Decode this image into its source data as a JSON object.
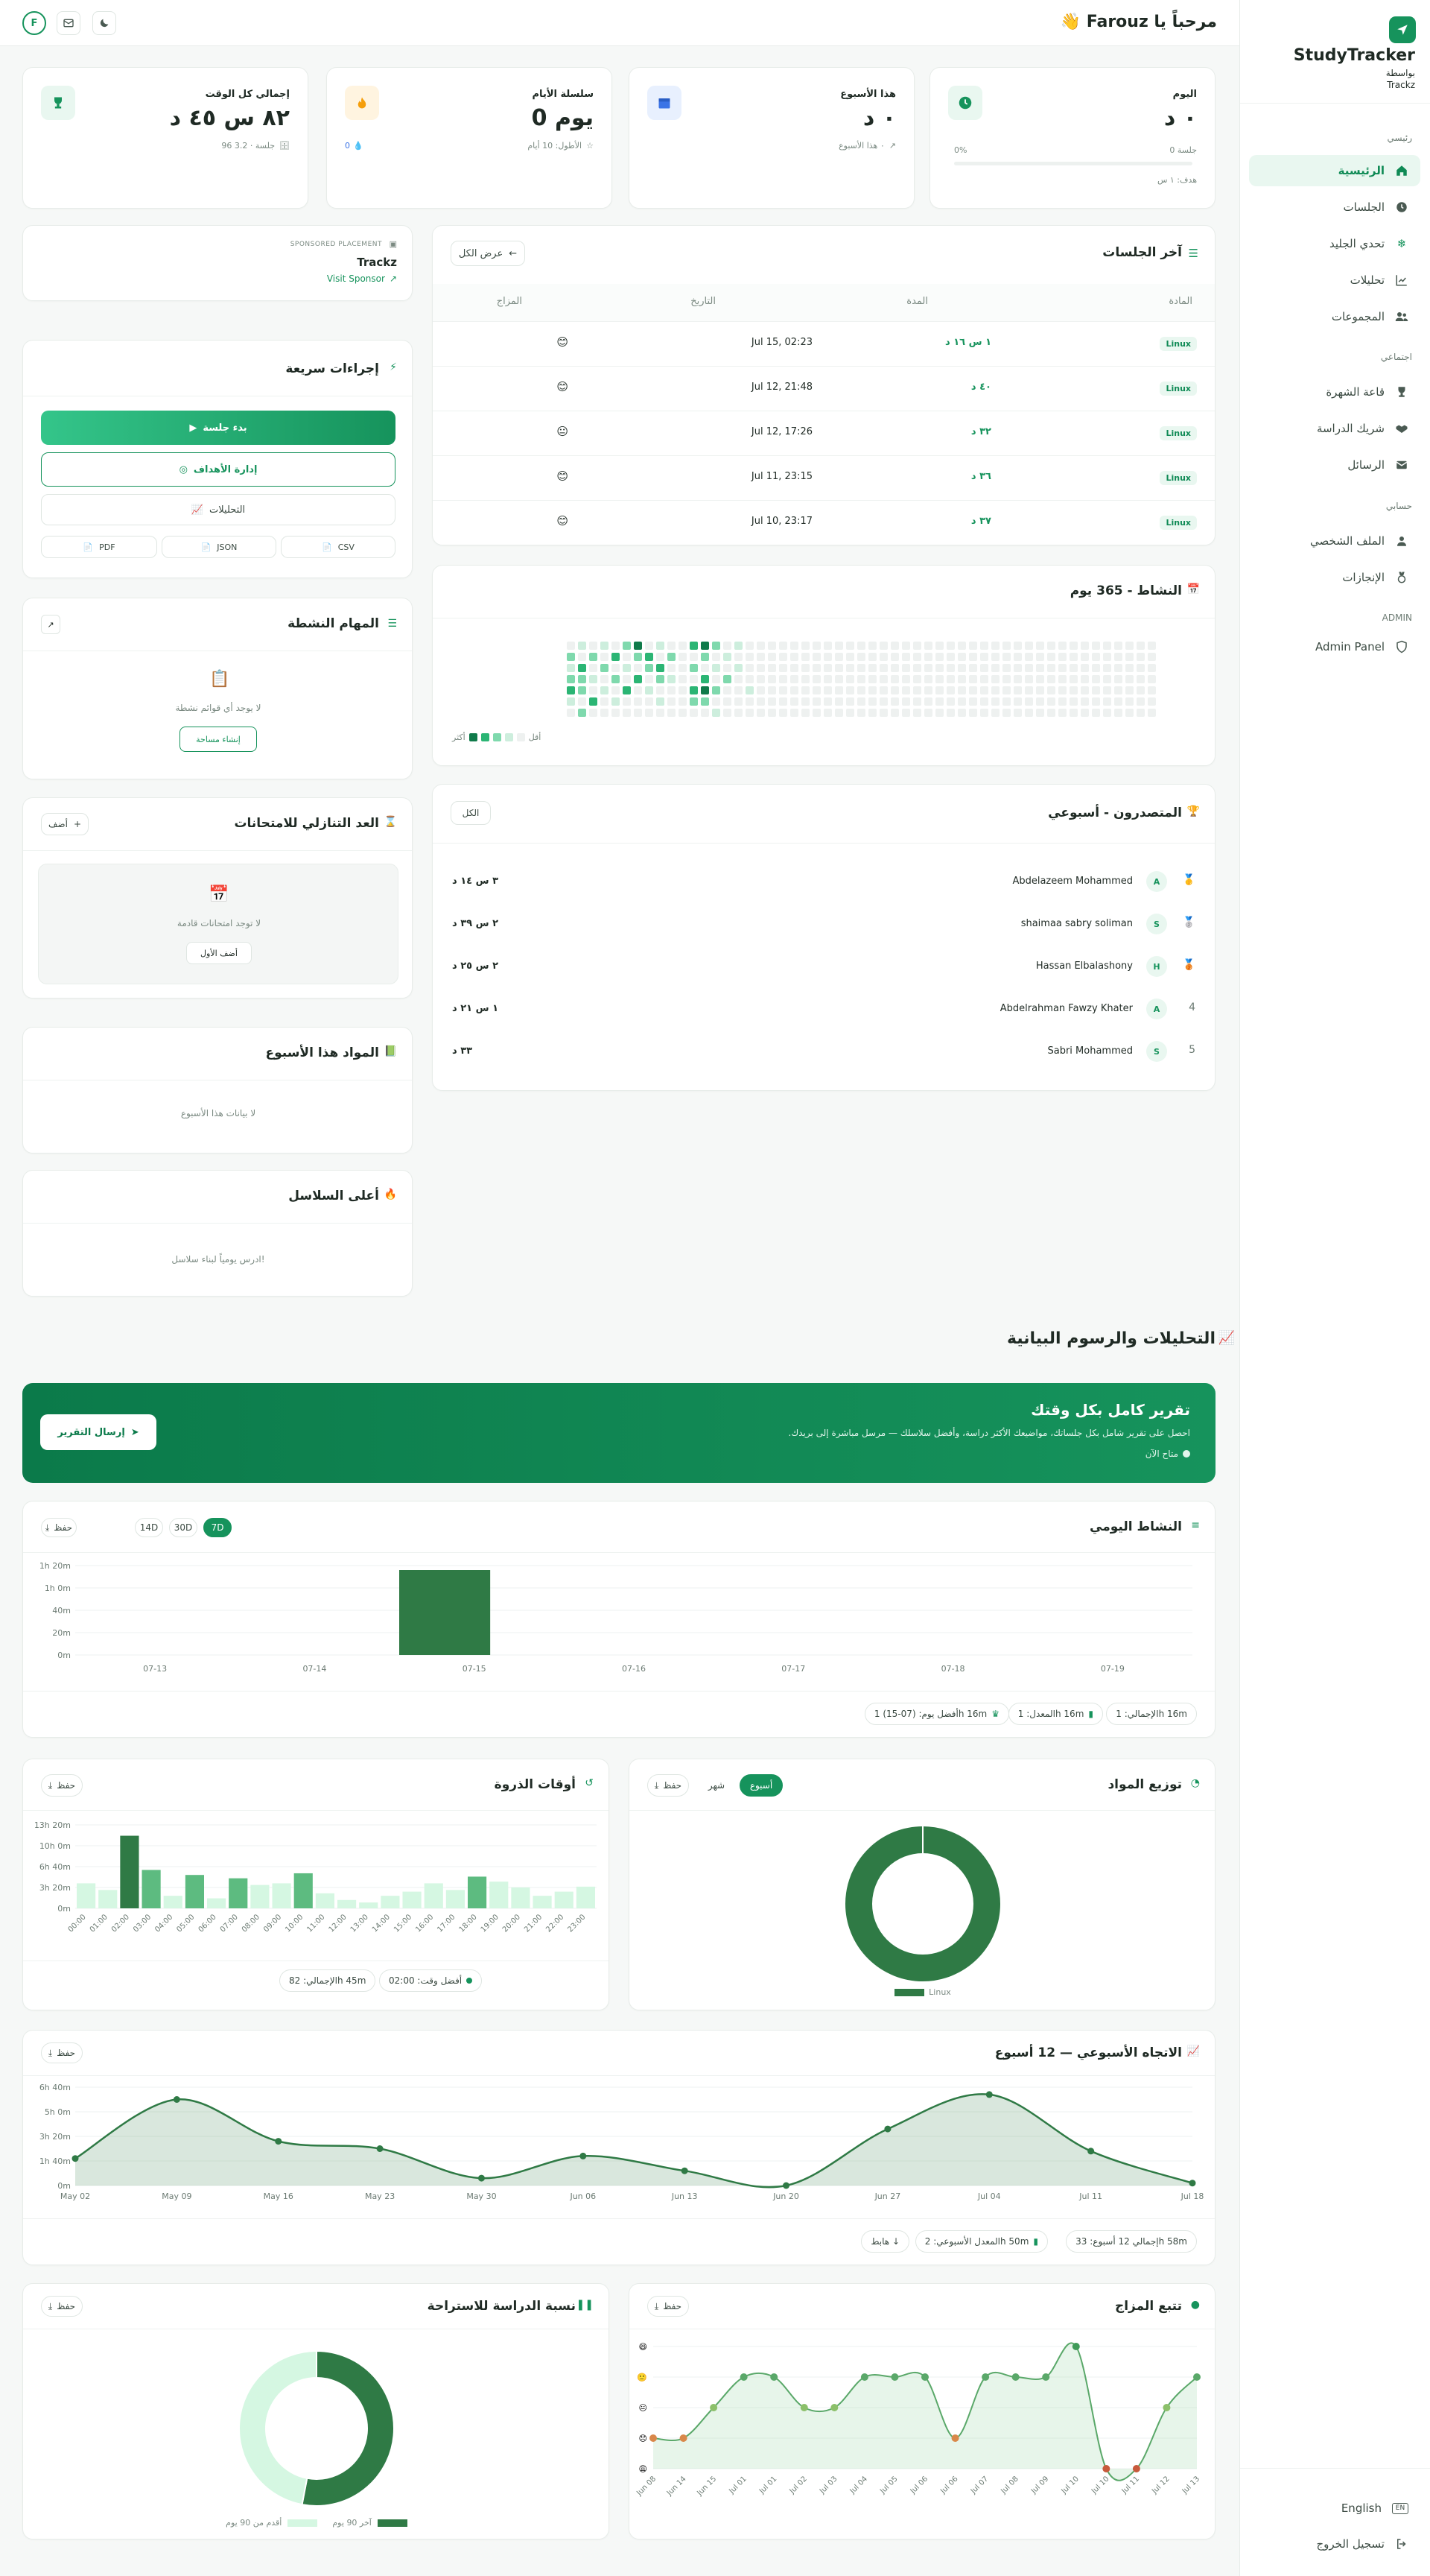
{
  "brand": {
    "name": "StudyTracker",
    "by": "بواسطة",
    "by_name": "Trackz"
  },
  "sidebar": {
    "sections": [
      "رئيسي",
      "اجتماعي",
      "حسابي",
      "ADMIN"
    ],
    "items": [
      {
        "label": "الرئيسية",
        "icon": "home-icon"
      },
      {
        "label": "الجلسات",
        "icon": "clock-icon"
      },
      {
        "label": "تحدي الجليد",
        "icon": "snowflake-icon"
      },
      {
        "label": "تحليلات",
        "icon": "chart-icon"
      },
      {
        "label": "المجموعات",
        "icon": "users-icon"
      },
      {
        "label": "قاعة الشهرة",
        "icon": "trophy-icon"
      },
      {
        "label": "شريك الدراسة",
        "icon": "handshake-icon"
      },
      {
        "label": "الرسائل",
        "icon": "mail-icon"
      },
      {
        "label": "الملف الشخصي",
        "icon": "user-icon"
      },
      {
        "label": "الإنجازات",
        "icon": "medal-icon"
      },
      {
        "label": "Admin Panel",
        "icon": "shield-icon"
      }
    ],
    "language": "English",
    "logout": "تسجيل الخروج"
  },
  "topbar": {
    "greeting": "مرحباً يا Farouz 👋",
    "avatar": "F"
  },
  "stats": [
    {
      "title": "اليوم",
      "value": "٠ د",
      "sub1": "0 جلسة",
      "progress": "0%",
      "goal": "هدف: ١ س",
      "progress_pct": 0
    },
    {
      "title": "هذا الأسبوع",
      "value": "٠ د",
      "sub1": "٠ هذا الأسبوع"
    },
    {
      "title": "سلسلة الأيام",
      "value": "0 يوم",
      "sub1": "الأطول: 10 أيام",
      "sub2": "0"
    },
    {
      "title": "إجمالي كل الوقت",
      "value": "٨٢ س ٤٥ د",
      "sub1": "96 جلسة · 3.2"
    }
  ],
  "sessions": {
    "title": "آخر الجلسات",
    "view_all": "عرض الكل",
    "headers": [
      "المادة",
      "المدة",
      "التاريخ",
      "المزاج"
    ],
    "rows": [
      {
        "subject": "Linux",
        "duration": "١ س ١٦ د",
        "date": "Jul 15, 02:23",
        "mood": "😊"
      },
      {
        "subject": "Linux",
        "duration": "٤٠ د",
        "date": "Jul 12, 21:48",
        "mood": "😊"
      },
      {
        "subject": "Linux",
        "duration": "٣٢ د",
        "date": "Jul 12, 17:26",
        "mood": "😐"
      },
      {
        "subject": "Linux",
        "duration": "٣٦ د",
        "date": "Jul 11, 23:15",
        "mood": "😊"
      },
      {
        "subject": "Linux",
        "duration": "٣٧ د",
        "date": "Jul 10, 23:17",
        "mood": "😊"
      }
    ]
  },
  "sponsor": {
    "label": "SPONSORED PLACEMENT",
    "name": "Trackz",
    "link": "Visit Sponsor"
  },
  "quick": {
    "title": "إجراءات سريعة",
    "start": "بدء جلسة",
    "goals": "إدارة الأهداف",
    "analytics": "التحليلات",
    "csv": "CSV",
    "json": "JSON",
    "pdf": "PDF"
  },
  "tasks": {
    "title": "المهام النشطة",
    "empty": "لا يوجد أي قوائم نشطة",
    "create": "إنشاء مساحة"
  },
  "exams": {
    "title": "العد التنازلي للامتحانات",
    "add": "أضف",
    "empty": "لا توجد امتحانات قادمة",
    "add_first": "أضف الأول"
  },
  "subjects_week": {
    "title": "المواد هذا الأسبوع",
    "empty": "لا بيانات هذا الأسبوع"
  },
  "top_streaks": {
    "title": "أعلى السلاسل",
    "empty": "ادرس يومياً لبناء سلاسل!"
  },
  "activity": {
    "title": "النشاط - 365 يوم",
    "less": "أقل",
    "more": "أكثر"
  },
  "leaders": {
    "title": "المتصدرون - أسبوعي",
    "all": "الكل",
    "rows": [
      {
        "rank": "🥇",
        "initial": "A",
        "name": "Abdelazeem Mohammed",
        "time": "٣ س ١٤ د"
      },
      {
        "rank": "🥈",
        "initial": "S",
        "name": "shaimaa sabry soliman",
        "time": "٢ س ٣٩ د"
      },
      {
        "rank": "🥉",
        "initial": "H",
        "name": "Hassan Elbalashony",
        "time": "٢ س ٢٥ د"
      },
      {
        "rank": "4",
        "initial": "A",
        "name": "Abdelrahman Fawzy Khater",
        "time": "١ س ٢١ د"
      },
      {
        "rank": "5",
        "initial": "S",
        "name": "Sabri Mohammed",
        "time": "٣٣ د"
      }
    ]
  },
  "analytics_title": "التحليلات والرسوم البيانية",
  "report": {
    "title": "تقرير كامل بكل وقتك",
    "desc": "احصل على تقرير شامل بكل جلساتك، مواضيعك الأكثر دراسة، وأفضل سلاسلك — مرسل مباشرة إلى بريدك.",
    "avail": "متاح الآن",
    "send": "إرسال التقرير"
  },
  "daily": {
    "title": "النشاط اليومي",
    "tabs": [
      "7D",
      "14D",
      "30D"
    ],
    "save": "حفظ",
    "total": "الإجمالي: 1h 16m",
    "avg": "المعدل: 1h 16m",
    "best": "أفضل يوم: (07-15) 1h 16m"
  },
  "peak": {
    "title": "أوقات الذروة",
    "save": "حفظ",
    "best": "أفضل وقت: 02:00",
    "total": "الإجمالي: 82h 45m"
  },
  "distribution": {
    "title": "توزيع المواد",
    "tabs": [
      "أسبوع",
      "شهر"
    ],
    "save": "حفظ",
    "legend": "Linux"
  },
  "weekly": {
    "title": "الاتجاه الأسبوعي — 12 أسبوع",
    "save": "حفظ",
    "total": "إجمالي 12 أسبوع: 33h 58m",
    "avg": "المعدل الأسبوعي: 2h 50m",
    "trend": "هابط ↓"
  },
  "ratio": {
    "title": "نسبة الدراسة للاستراحة",
    "save": "حفظ",
    "l1": "أقدم من 90 يوم",
    "l2": "آخر 90 يوم"
  },
  "mood": {
    "title": "تتبع المزاج",
    "save": "حفظ"
  },
  "chart_data": [
    {
      "type": "bar",
      "title": "النشاط اليومي",
      "categories": [
        "07-13",
        "07-14",
        "07-15",
        "07-16",
        "07-17",
        "07-18",
        "07-19"
      ],
      "values": [
        0,
        0,
        76,
        0,
        0,
        0,
        0
      ],
      "ylim": [
        0,
        80
      ],
      "yticks": [
        "0m",
        "20m",
        "40m",
        "1h 0m",
        "1h 20m"
      ]
    },
    {
      "type": "bar",
      "title": "أوقات الذروة",
      "categories": [
        "00:00",
        "01:00",
        "02:00",
        "03:00",
        "04:00",
        "05:00",
        "06:00",
        "07:00",
        "08:00",
        "09:00",
        "10:00",
        "11:00",
        "12:00",
        "13:00",
        "14:00",
        "15:00",
        "16:00",
        "17:00",
        "18:00",
        "19:00",
        "20:00",
        "21:00",
        "22:00",
        "23:00"
      ],
      "values": [
        300,
        220,
        870,
        460,
        150,
        400,
        120,
        360,
        280,
        300,
        420,
        180,
        100,
        70,
        150,
        200,
        300,
        220,
        380,
        320,
        250,
        150,
        200,
        260
      ],
      "ylim": [
        0,
        1000
      ],
      "yticks": [
        "0m",
        "3h 20m",
        "6h 40m",
        "10h 0m",
        "13h 20m"
      ]
    },
    {
      "type": "pie",
      "title": "توزيع المواد",
      "categories": [
        "Linux"
      ],
      "values": [
        100
      ]
    },
    {
      "type": "area",
      "title": "الاتجاه الأسبوعي — 12 أسبوع",
      "categories": [
        "May 02",
        "May 09",
        "May 16",
        "May 23",
        "May 30",
        "Jun 06",
        "Jun 13",
        "Jun 20",
        "Jun 27",
        "Jul 04",
        "Jul 11",
        "Jul 18"
      ],
      "values": [
        110,
        350,
        180,
        150,
        30,
        120,
        60,
        0,
        230,
        370,
        140,
        10
      ],
      "ylim": [
        0,
        400
      ],
      "yticks": [
        "0m",
        "1h 40m",
        "3h 20m",
        "5h 0m",
        "6h 40m"
      ]
    },
    {
      "type": "pie",
      "title": "نسبة الدراسة للاستراحة",
      "categories": [
        "آخر 90 يوم",
        "أقدم من 90 يوم"
      ],
      "values": [
        53,
        47
      ]
    },
    {
      "type": "line",
      "title": "تتبع المزاج",
      "categories": [
        "Jun 08",
        "Jun 14",
        "Jun 15",
        "Jul 01",
        "Jul 01",
        "Jul 02",
        "Jul 03",
        "Jul 04",
        "Jul 05",
        "Jul 06",
        "Jul 06",
        "Jul 07",
        "Jul 08",
        "Jul 09",
        "Jul 10",
        "Jul 10",
        "Jul 11",
        "Jul 12",
        "Jul 13"
      ],
      "values": [
        2,
        2,
        3,
        4,
        4,
        3,
        3,
        4,
        4,
        4,
        2,
        4,
        4,
        4,
        5,
        1,
        1,
        3,
        4
      ],
      "ylim": [
        1,
        5
      ]
    }
  ]
}
